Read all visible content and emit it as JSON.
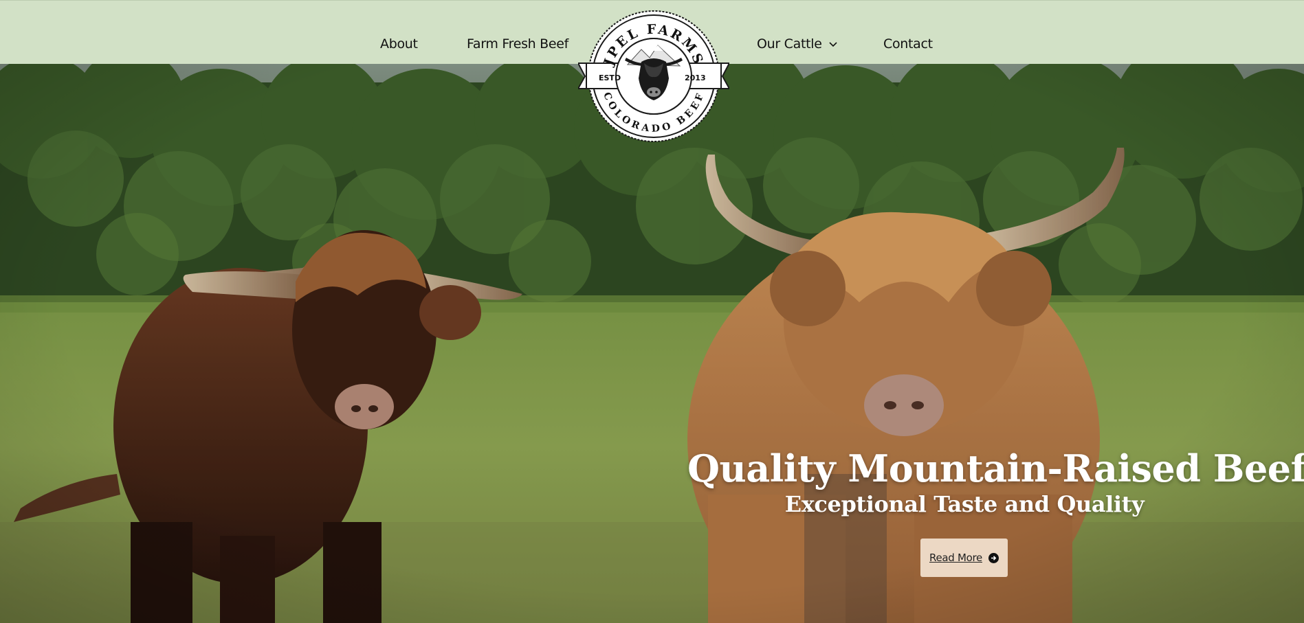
{
  "nav": {
    "items": [
      {
        "label": "About"
      },
      {
        "label": "Farm Fresh Beef"
      },
      {
        "label": "Our Cattle"
      },
      {
        "label": "Contact"
      }
    ],
    "chevron_icon": "chevron-down-icon"
  },
  "logo": {
    "text_top": "JPEL FARMS",
    "text_bottom": "COLORADO BEEF",
    "left_badge": "ESTD",
    "right_badge": "2013",
    "emblem": "highland-cow-mountain-icon"
  },
  "hero": {
    "title": "Quality Mountain-Raised Beef",
    "subtitle": "Exceptional Taste and Quality",
    "cta_label": "Read More",
    "cta_icon": "arrow-right-circle-icon"
  },
  "colors": {
    "header_bg": "#d2e1c6",
    "cta_bg": "#ecd8c4",
    "hero_text": "#ffffff"
  }
}
